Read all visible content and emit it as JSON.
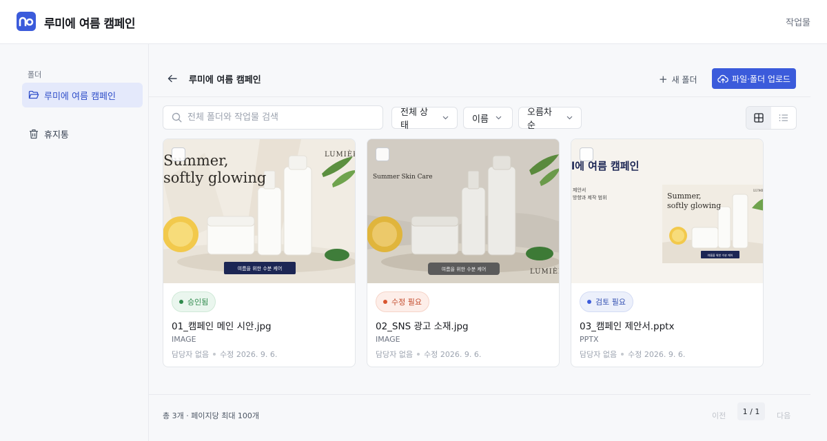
{
  "header": {
    "app_title": "루미에 여름 캠페인",
    "right_link": "작업물"
  },
  "sidebar": {
    "section_label": "폴더",
    "items": [
      {
        "label": "루미에 여름 캠페인",
        "icon": "folder-open-icon",
        "active": true
      },
      {
        "label": "휴지통",
        "icon": "trash-icon",
        "active": false
      }
    ]
  },
  "toolbar": {
    "title": "루미에 여름 캠페인",
    "new_folder_label": "새 폴더",
    "upload_label": "파일·폴더 업로드"
  },
  "filters": {
    "search_placeholder": "전체 폴더와 작업물 검색",
    "status": "전체 상태",
    "sort_field": "이름",
    "sort_order": "오름차순",
    "view_mode": "grid"
  },
  "files": [
    {
      "status": "승인됨",
      "name": "01_캠페인 메인 시안.jpg",
      "type": "IMAGE",
      "assignee": "담당자 없음",
      "modified": "수정 2026. 9. 6.",
      "thumb": {
        "headline1": "Summer,",
        "headline2": "softly glowing",
        "brand": "LUMIÈRE",
        "cta": "여름을 위한 수분 케어"
      }
    },
    {
      "status": "수정 필요",
      "name": "02_SNS 광고 소재.jpg",
      "type": "IMAGE",
      "assignee": "담당자 없음",
      "modified": "수정 2026. 9. 6.",
      "thumb": {
        "headline1": "Summer Skin Care",
        "brand": "LUMIÈRE",
        "cta": "여름을 위한 수분 케어"
      }
    },
    {
      "status": "검토 필요",
      "name": "03_캠페인 제안서.pptx",
      "type": "PPTX",
      "assignee": "담당자 없음",
      "modified": "수정 2026. 9. 6.",
      "thumb": {
        "slide_title": "l에 여름 캠페인",
        "line1": "제안서",
        "line2": "방향과 제작 범위",
        "headline1": "Summer,",
        "headline2": "softly glowing",
        "brand": "LUMIÈ",
        "cta": "여름을 위한 수분 케어"
      }
    }
  ],
  "footer": {
    "total": "총 3개 · 페이지당 최대 100개",
    "prev": "이전",
    "page": "1 / 1",
    "next": "다음"
  },
  "colors": {
    "accent": "#3b5bdb",
    "approved": "#2f8a4c",
    "revise": "#d9552f",
    "review": "#3b5bdb"
  }
}
